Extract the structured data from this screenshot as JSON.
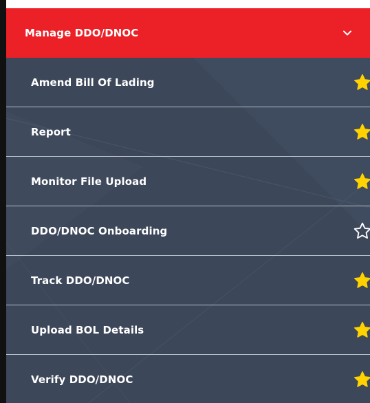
{
  "menu": {
    "title": "Manage DDO/DNOC",
    "expanded": true,
    "header_color": "#ec2027",
    "item_bg_color": "#3c4759",
    "star_filled_color": "#ffd200",
    "star_outline_color": "#ffffff",
    "items": [
      {
        "label": "Amend Bill Of Lading",
        "favorite": true,
        "icon": "star-filled-icon"
      },
      {
        "label": "Report",
        "favorite": true,
        "icon": "star-filled-icon"
      },
      {
        "label": "Monitor File Upload",
        "favorite": true,
        "icon": "star-filled-icon"
      },
      {
        "label": "DDO/DNOC Onboarding",
        "favorite": false,
        "icon": "star-outline-icon"
      },
      {
        "label": "Track DDO/DNOC",
        "favorite": true,
        "icon": "star-filled-icon"
      },
      {
        "label": "Upload BOL Details",
        "favorite": true,
        "icon": "star-filled-icon"
      },
      {
        "label": "Verify DDO/DNOC",
        "favorite": true,
        "icon": "star-filled-icon"
      }
    ]
  }
}
